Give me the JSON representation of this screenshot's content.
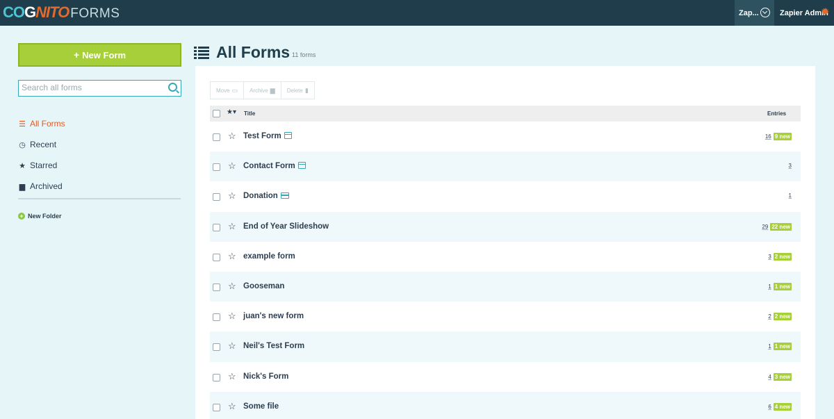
{
  "header": {
    "logo_text": "COGNITO",
    "logo_suffix": "FORMS",
    "org_label": "Zap...",
    "user_name": "Zapier Admin",
    "colors": {
      "bar": "#1f3d4a",
      "accent": "#e36a2c",
      "teal": "#4ec3d3"
    }
  },
  "sidebar": {
    "new_form_label": "New Form",
    "search_placeholder": "Search all forms",
    "items": [
      {
        "label": "All Forms",
        "icon": "list-icon",
        "active": true
      },
      {
        "label": "Recent",
        "icon": "clock-icon",
        "active": false
      },
      {
        "label": "Starred",
        "icon": "star-icon",
        "active": false
      },
      {
        "label": "Archived",
        "icon": "archive-box-icon",
        "active": false
      }
    ],
    "new_folder_label": "New Folder"
  },
  "main": {
    "title": "All Forms",
    "count_label": "11 forms",
    "toolbar": {
      "move": "Move",
      "archive": "Archive",
      "delete": "Delete"
    },
    "columns": {
      "title": "Title",
      "entries": "Entries"
    },
    "rows": [
      {
        "title": "Test Form",
        "icon": "calendar-icon",
        "count": "16",
        "new": "9 new"
      },
      {
        "title": "Contact Form",
        "icon": "calendar-icon",
        "count": "3",
        "new": ""
      },
      {
        "title": "Donation",
        "icon": "credit-card-icon",
        "count": "1",
        "new": ""
      },
      {
        "title": "End of Year Slideshow",
        "icon": "",
        "count": "29",
        "new": "22 new"
      },
      {
        "title": "example form",
        "icon": "",
        "count": "3",
        "new": "2 new"
      },
      {
        "title": "Gooseman",
        "icon": "",
        "count": "1",
        "new": "1 new"
      },
      {
        "title": "juan's new form",
        "icon": "",
        "count": "2",
        "new": "2 new"
      },
      {
        "title": "Neil's Test Form",
        "icon": "",
        "count": "1",
        "new": "1 new"
      },
      {
        "title": "Nick's Form",
        "icon": "",
        "count": "4",
        "new": "3 new"
      },
      {
        "title": "Some file",
        "icon": "",
        "count": "6",
        "new": "4 new"
      }
    ]
  }
}
